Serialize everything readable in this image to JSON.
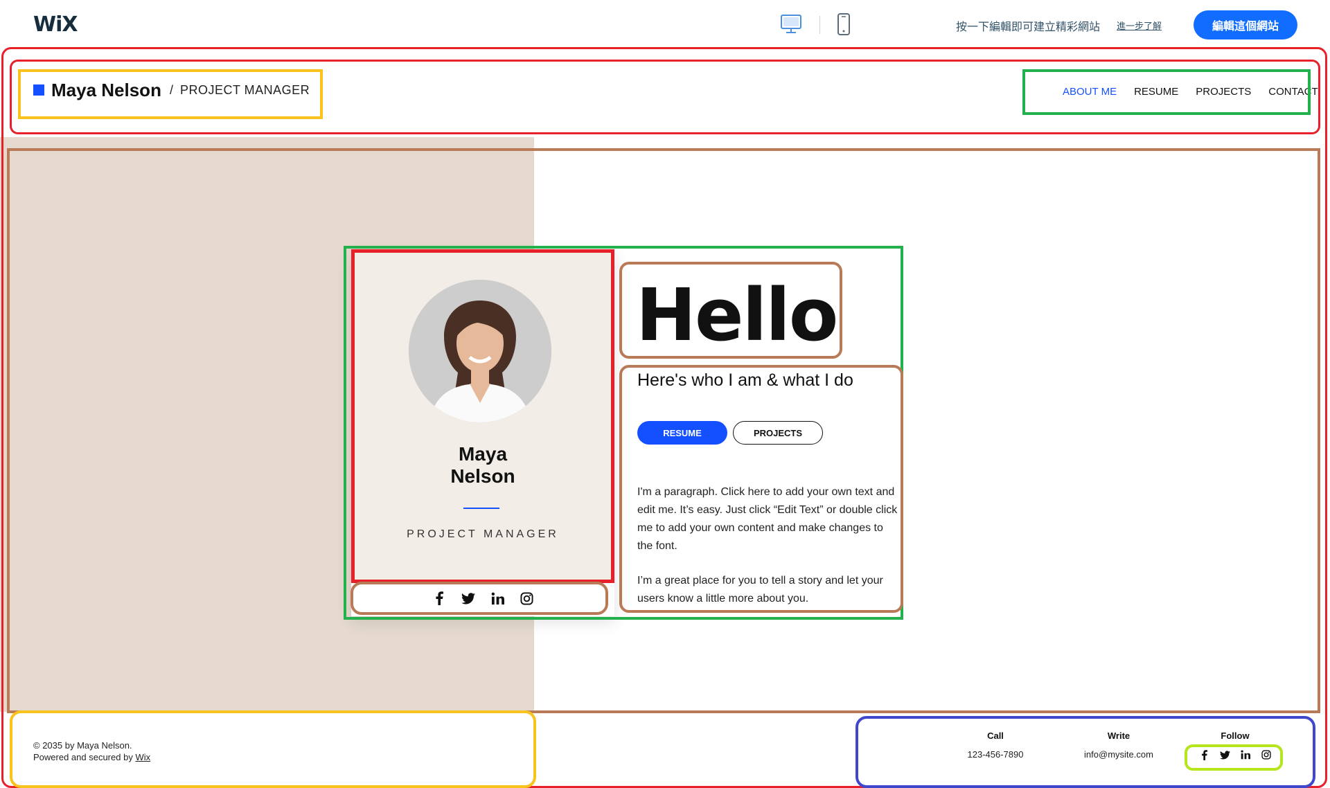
{
  "wix_bar": {
    "logo": "WiX",
    "hint_text": "按一下編輯即可建立精彩網站",
    "learn_more": "進一步了解",
    "edit_button": "編輯這個網站",
    "desktop_icon": "desktop-icon",
    "mobile_icon": "mobile-icon"
  },
  "header": {
    "name": "Maya Nelson",
    "separator": "/",
    "role": "PROJECT MANAGER",
    "brand_color": "#1450ff",
    "nav": [
      {
        "label": "ABOUT ME",
        "active": true
      },
      {
        "label": "RESUME",
        "active": false
      },
      {
        "label": "PROJECTS",
        "active": false
      },
      {
        "label": "CONTACT",
        "active": false
      }
    ]
  },
  "profile_card": {
    "first_name": "Maya",
    "last_name": "Nelson",
    "role": "PROJECT MANAGER",
    "social": [
      "facebook-icon",
      "twitter-icon",
      "linkedin-icon",
      "instagram-icon"
    ]
  },
  "intro": {
    "heading": "Hello",
    "tagline": "Here's who I am & what I do",
    "resume_button": "RESUME",
    "projects_button": "PROJECTS",
    "paragraph1": "I'm a paragraph. Click here to add your own text and edit me. It’s easy. Just click “Edit Text” or double click me to add your own content and make changes to the font.",
    "paragraph2": "I’m a great place for you to tell a story and let your users know a little more about you."
  },
  "footer": {
    "copyright_line1": "© 2035 by Maya Nelson.",
    "copyright_line2_prefix": "Powered and secured by ",
    "copyright_link": "Wix",
    "call_label": "Call",
    "call_value": "123-456-7890",
    "write_label": "Write",
    "write_value": "info@mysite.com",
    "follow_label": "Follow"
  },
  "colors": {
    "accent": "#1450ff",
    "hero_left_bg": "#e6dace",
    "card_bg": "#f3ede8",
    "wix_blue": "#116dff"
  }
}
